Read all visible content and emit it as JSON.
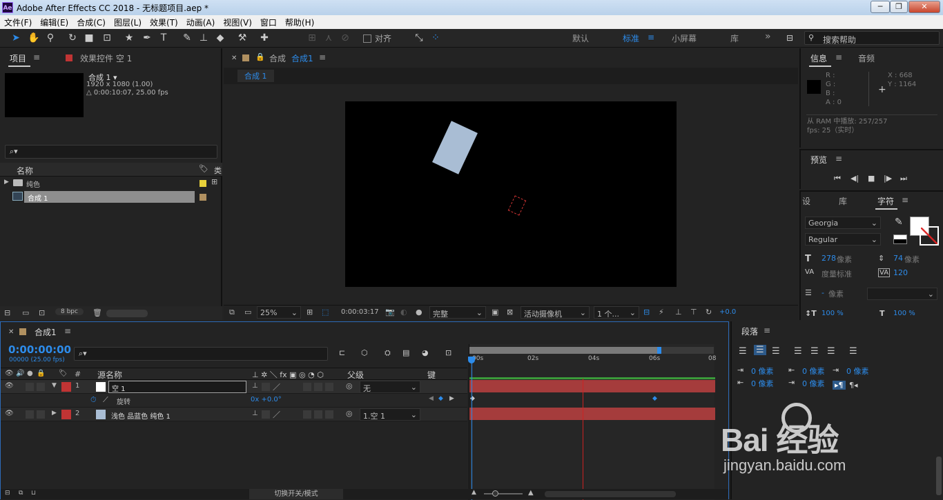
{
  "window": {
    "title": "Adobe After Effects CC 2018 - 无标题项目.aep *",
    "app_badge": "Ae",
    "min": "─",
    "max": "❐",
    "close": "✕"
  },
  "menu": [
    "文件(F)",
    "编辑(E)",
    "合成(C)",
    "图层(L)",
    "效果(T)",
    "动画(A)",
    "视图(V)",
    "窗口",
    "帮助(H)"
  ],
  "toolbar": {
    "align_label": "对齐",
    "workspaces": [
      "默认",
      "标准",
      "小屏幕",
      "库"
    ],
    "active_workspace": "标准",
    "more": "»",
    "search_placeholder": "搜索帮助"
  },
  "project": {
    "tab": "项目",
    "effects_tab": "效果控件 空 1",
    "comp_name": "合成 1 ▾",
    "comp_size": "1920 x 1080 (1.00)",
    "comp_duration": "△ 0:00:10:07, 25.00 fps",
    "search_icon": "⌕▾",
    "col_name": "名称",
    "col_type": "类",
    "items": [
      {
        "name": "纯色",
        "type": "folder",
        "label_color": "#e8d13a"
      },
      {
        "name": "合成 1",
        "type": "comp",
        "label_color": "#b09060"
      }
    ],
    "bpc": "8 bpc"
  },
  "viewer": {
    "tab_prefix": "合成",
    "tab_comp": "合成1",
    "subtab": "合成 1",
    "zoom": "25%",
    "timecode": "0:00:03:17",
    "quality": "完整",
    "camera": "活动摄像机",
    "views": "1 个...",
    "exposure": "+0.0"
  },
  "info": {
    "tab": "信息",
    "audio_tab": "音频",
    "r": "R :",
    "g": "G :",
    "b": "B :",
    "a": "A : 0",
    "x": "X : 668",
    "y": "Y : 1164",
    "ram": "从 RAM 中播放: 257/257",
    "fps": "fps: 25（实时）"
  },
  "preview": {
    "tab": "预览"
  },
  "character": {
    "tabs": [
      "设",
      "库",
      "字符"
    ],
    "font": "Georgia",
    "style": "Regular",
    "size_value": "278",
    "size_unit": "像素",
    "leading_value": "74",
    "leading_unit": "像素",
    "kerning": "度量标准",
    "tracking": "120",
    "stroke_value": "-",
    "stroke_unit": "像素",
    "v_scale": "100 %",
    "h_scale": "100 %"
  },
  "paragraph": {
    "tab": "段落",
    "indent_values": [
      "0 像素",
      "0 像素",
      "0 像素",
      "0 像素",
      "0 像素"
    ]
  },
  "timeline": {
    "tab": "合成1",
    "timecode": "0:00:00:00",
    "timecode_sub": "00000 (25.00 fps)",
    "col_source": "源名称",
    "col_parent": "父级",
    "col_keys": "键",
    "col_num": "#",
    "switch_label": "切换开关/模式",
    "ruler": [
      "00s",
      "02s",
      "04s",
      "06s",
      "08"
    ],
    "layers": [
      {
        "num": "1",
        "name": "空 1",
        "color": "#c03434",
        "parent": "无",
        "expanded": true
      },
      {
        "num": "2",
        "name": "浅色 品蓝色 纯色 1",
        "color": "#c03434",
        "parent": "1.空 1",
        "expanded": false
      }
    ],
    "property": {
      "name": "旋转",
      "value": "0x +0.0°"
    }
  },
  "watermark": {
    "brand": "Bai 经验",
    "url": "jingyan.baidu.com"
  }
}
